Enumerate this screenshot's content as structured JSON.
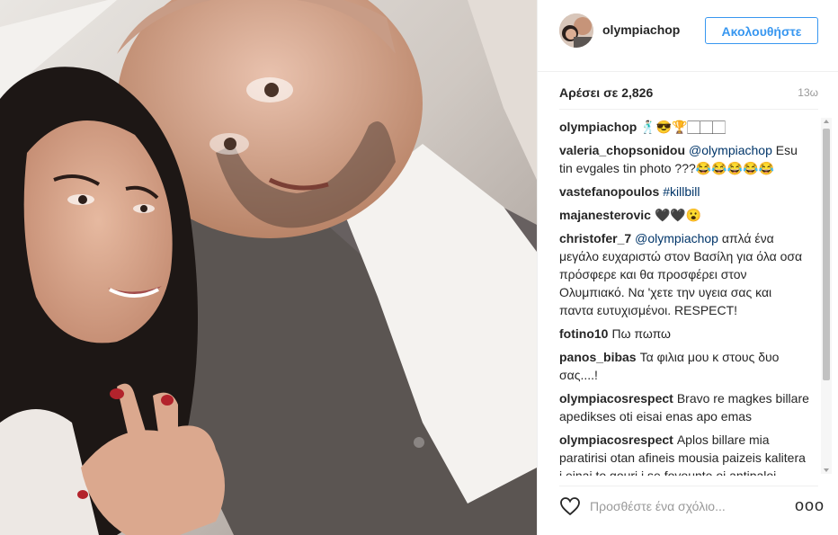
{
  "post": {
    "username": "olympiachop",
    "follow_label": "Ακολουθήστε",
    "likes": "Αρέσει σε 2,826",
    "time_ago": "13ω"
  },
  "comments": [
    {
      "user": "olympiachop",
      "text": "🕺🏻😎🏆🏻🏻🏻"
    },
    {
      "user": "valeria_chopsonidou",
      "tag": "@olympiachop",
      "text": "Esu tin evgales tin photo ???😂😂😂😂😂"
    },
    {
      "user": "vastefanopoulos",
      "tag": "#killbill",
      "text": ""
    },
    {
      "user": "majanesterovic",
      "text": "🖤🖤😮"
    },
    {
      "user": "christofer_7",
      "tag": "@olympiachop",
      "text": "απλά ένα μεγάλο ευχαριστώ στον Βασίλη για όλα οσα πρόσφερε και θα προσφέρει στον Ολυμπιακό. Να 'χετε την υγεια σας και παντα ευτυχισμένοι. RESPECT!"
    },
    {
      "user": "fotino10",
      "text": "Πω πωπω"
    },
    {
      "user": "panos_bibas",
      "text": "Τα φιλια μου κ στους δυο σας....!"
    },
    {
      "user": "olympiacosrespect",
      "text": "Bravo re magkes billare apedikses oti eisai enas apo emas"
    },
    {
      "user": "olympiacosrespect",
      "text": "Aplos billare mia paratirisi otan afineis mousia paizeis kalitera i einai to gouri i se fovounte oi antipaloi perissotero :) opote kseris se"
    }
  ],
  "footer": {
    "comment_placeholder": "Προσθέστε ένα σχόλιο...",
    "more_label": "ooo"
  },
  "icons": {
    "like": "heart-icon",
    "more": "more-options-icon"
  },
  "colors": {
    "accent": "#3897f0",
    "link": "#003569"
  }
}
